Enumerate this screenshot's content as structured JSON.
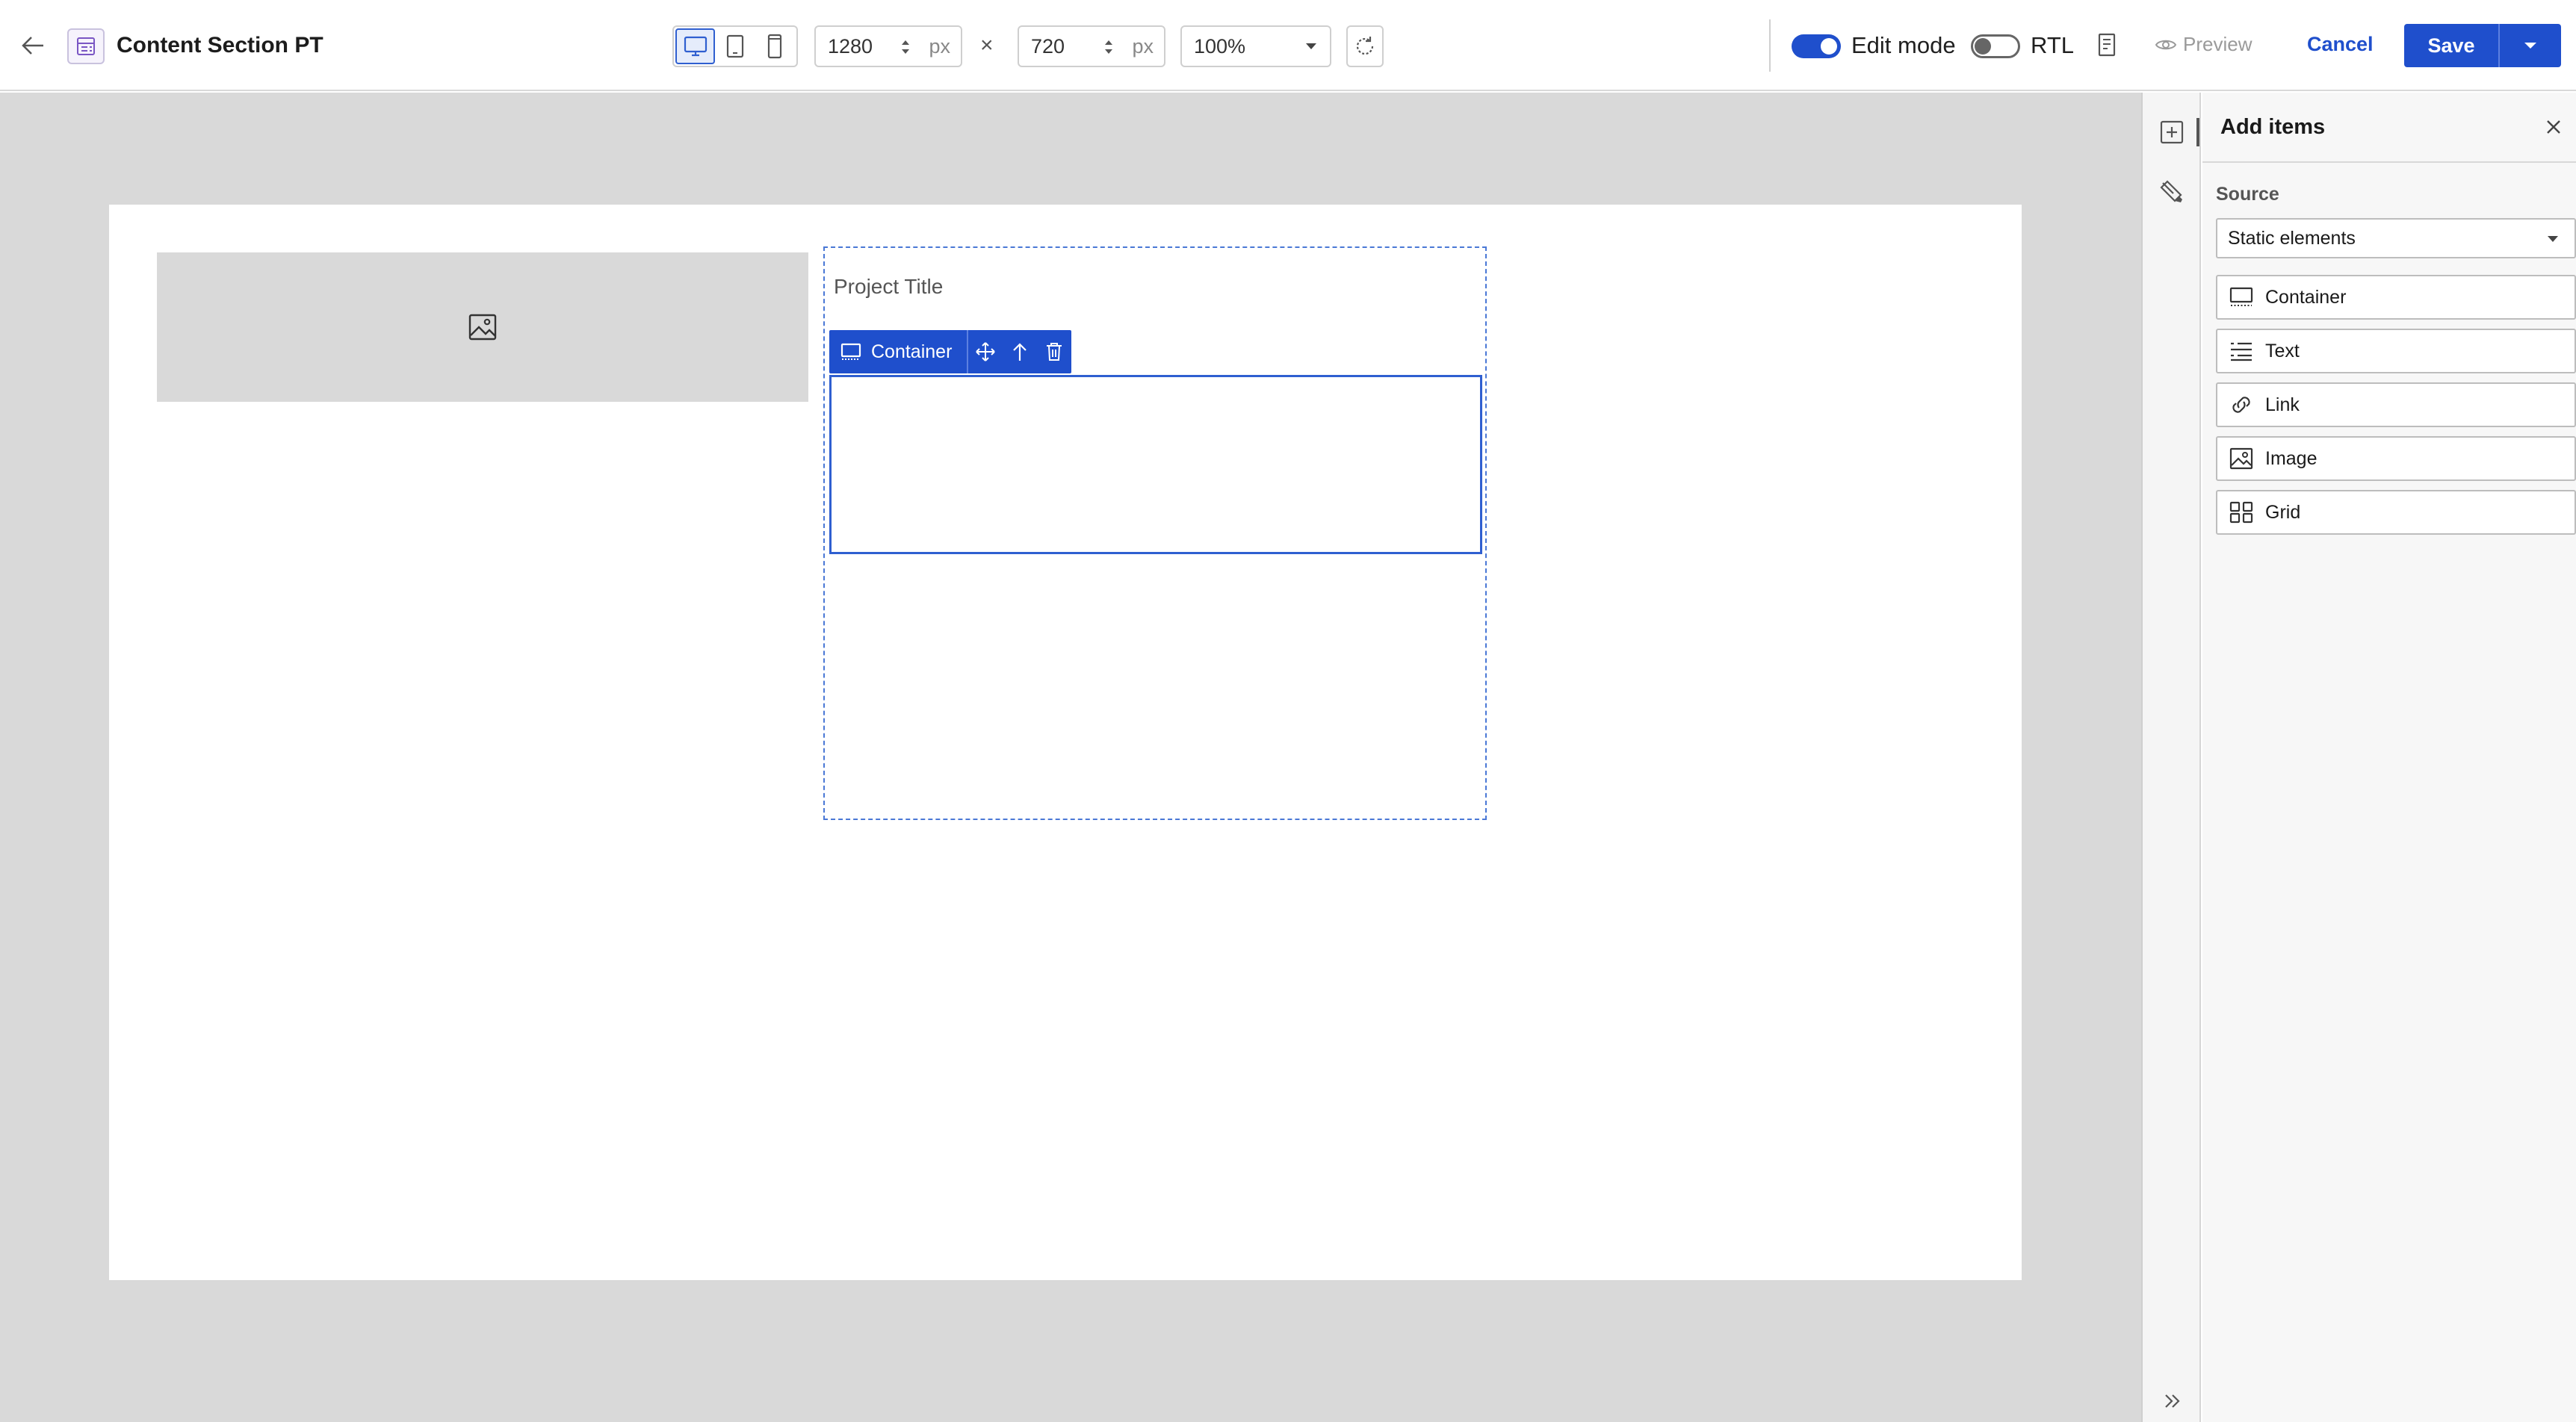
{
  "header": {
    "title": "Content Section PT",
    "width_value": "1280",
    "height_value": "720",
    "unit": "px",
    "times_symbol": "×",
    "zoom": "100%",
    "edit_mode_label": "Edit mode",
    "edit_mode_on": true,
    "rtl_label": "RTL",
    "rtl_on": false,
    "preview_label": "Preview",
    "cancel_label": "Cancel",
    "save_label": "Save",
    "active_device": "desktop"
  },
  "canvas": {
    "project_title": "Project Title",
    "selected_element_label": "Container"
  },
  "panel": {
    "title": "Add items",
    "source_label": "Source",
    "source_value": "Static elements",
    "items": [
      {
        "label": "Container",
        "icon": "container-icon"
      },
      {
        "label": "Text",
        "icon": "text-icon"
      },
      {
        "label": "Link",
        "icon": "link-icon"
      },
      {
        "label": "Image",
        "icon": "image-icon"
      },
      {
        "label": "Grid",
        "icon": "grid-icon"
      }
    ]
  },
  "colors": {
    "accent": "#1f4fcc",
    "canvas_bg": "#d9d9d9",
    "selection": "#2f5fd0"
  }
}
